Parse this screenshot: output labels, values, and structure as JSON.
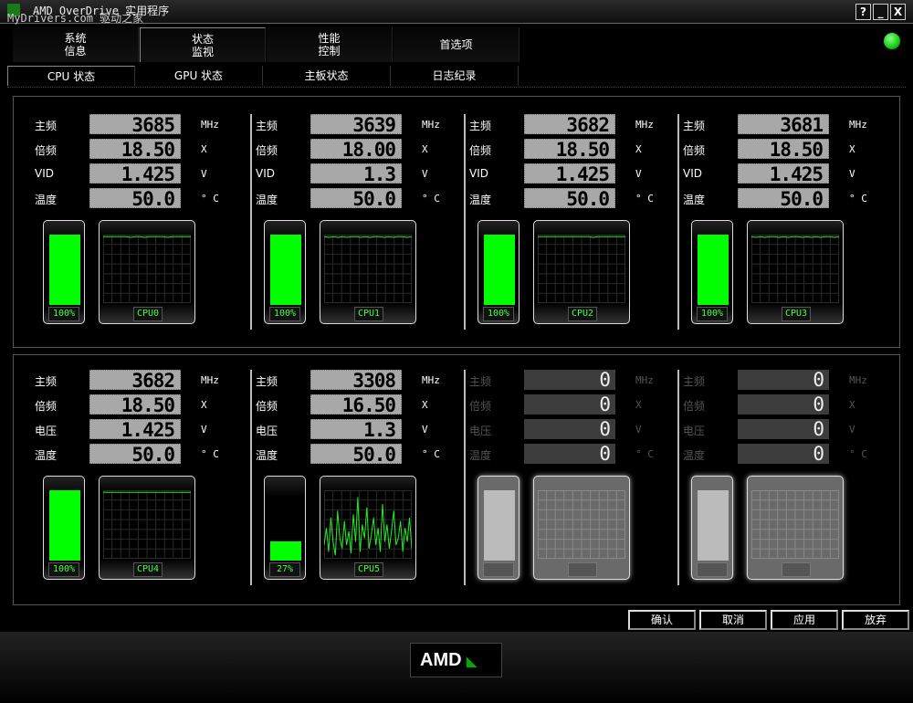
{
  "window": {
    "title": "AMD OverDrive 实用程序",
    "overlay": "MyDrivers.com 驱动之家",
    "help": "?",
    "minimize": "_",
    "close": "X"
  },
  "tabs": [
    {
      "label": "系统\n信息"
    },
    {
      "label": "状态\n监视",
      "active": true
    },
    {
      "label": "性能\n控制"
    },
    {
      "label": "首选项"
    }
  ],
  "subtabs": [
    {
      "label": "CPU 状态",
      "active": true
    },
    {
      "label": "GPU 状态"
    },
    {
      "label": "主板状态"
    },
    {
      "label": "日志纪录"
    }
  ],
  "status_led_color": "#22cc22",
  "units": [
    "MHz",
    "X",
    "V",
    "° C"
  ],
  "cores": [
    {
      "name": "CPU0",
      "labels": [
        "主频",
        "倍频",
        "VID",
        "温度"
      ],
      "values": [
        "3685",
        "18.50",
        "1.425",
        "50.0"
      ],
      "usage": "100%",
      "usage_pct": 100,
      "history": [
        97,
        97,
        97,
        97,
        97,
        97,
        96,
        97,
        97,
        96,
        97,
        97,
        97,
        97,
        96,
        97,
        97,
        97,
        97,
        97
      ],
      "enabled": true
    },
    {
      "name": "CPU1",
      "labels": [
        "主频",
        "倍频",
        "VID",
        "温度"
      ],
      "values": [
        "3639",
        "18.00",
        "1.3",
        "50.0"
      ],
      "usage": "100%",
      "usage_pct": 100,
      "history": [
        97,
        96,
        97,
        96,
        97,
        96,
        97,
        97,
        96,
        97,
        96,
        97,
        97,
        96,
        97,
        96,
        97,
        97,
        96,
        97
      ],
      "enabled": true
    },
    {
      "name": "CPU2",
      "labels": [
        "主频",
        "倍频",
        "VID",
        "温度"
      ],
      "values": [
        "3682",
        "18.50",
        "1.425",
        "50.0"
      ],
      "usage": "100%",
      "usage_pct": 100,
      "history": [
        97,
        97,
        97,
        97,
        97,
        97,
        97,
        97,
        97,
        97,
        97,
        97,
        96,
        97,
        97,
        97,
        97,
        97,
        97,
        97
      ],
      "enabled": true
    },
    {
      "name": "CPU3",
      "labels": [
        "主频",
        "倍频",
        "VID",
        "温度"
      ],
      "values": [
        "3681",
        "18.50",
        "1.425",
        "50.0"
      ],
      "usage": "100%",
      "usage_pct": 100,
      "history": [
        97,
        96,
        97,
        96,
        97,
        97,
        96,
        97,
        96,
        97,
        97,
        96,
        97,
        96,
        97,
        96,
        97,
        97,
        96,
        97
      ],
      "enabled": true
    },
    {
      "name": "CPU4",
      "labels": [
        "主频",
        "倍频",
        "电压",
        "温度"
      ],
      "values": [
        "3682",
        "18.50",
        "1.425",
        "50.0"
      ],
      "usage": "100%",
      "usage_pct": 100,
      "history": [
        97,
        97,
        97,
        97,
        97,
        97,
        97,
        97,
        97,
        97,
        97,
        97,
        97,
        97,
        97,
        97,
        97,
        97,
        97,
        97
      ],
      "enabled": true
    },
    {
      "name": "CPU5",
      "labels": [
        "主频",
        "倍频",
        "电压",
        "温度"
      ],
      "values": [
        "3308",
        "16.50",
        "1.3",
        "50.0"
      ],
      "usage": "27%",
      "usage_pct": 27,
      "history": [
        20,
        45,
        10,
        60,
        25,
        5,
        70,
        30,
        15,
        55,
        20,
        40,
        8,
        65,
        25,
        90,
        10,
        50,
        30,
        75,
        15,
        35,
        60,
        20,
        45,
        10,
        80,
        25,
        50,
        15,
        40,
        70,
        20,
        30,
        55,
        10,
        45,
        25,
        60,
        15
      ],
      "enabled": true
    },
    {
      "name": "",
      "labels": [
        "主频",
        "倍频",
        "电压",
        "温度"
      ],
      "values": [
        "0",
        "0",
        "0",
        "0"
      ],
      "usage": "",
      "usage_pct": 0,
      "history": [],
      "enabled": false
    },
    {
      "name": "",
      "labels": [
        "主频",
        "倍频",
        "电压",
        "温度"
      ],
      "values": [
        "0",
        "0",
        "0",
        "0"
      ],
      "usage": "",
      "usage_pct": 0,
      "history": [],
      "enabled": false
    }
  ],
  "buttons": [
    "确认",
    "取消",
    "应用",
    "放弃"
  ],
  "brand": {
    "logo": "AMD"
  }
}
